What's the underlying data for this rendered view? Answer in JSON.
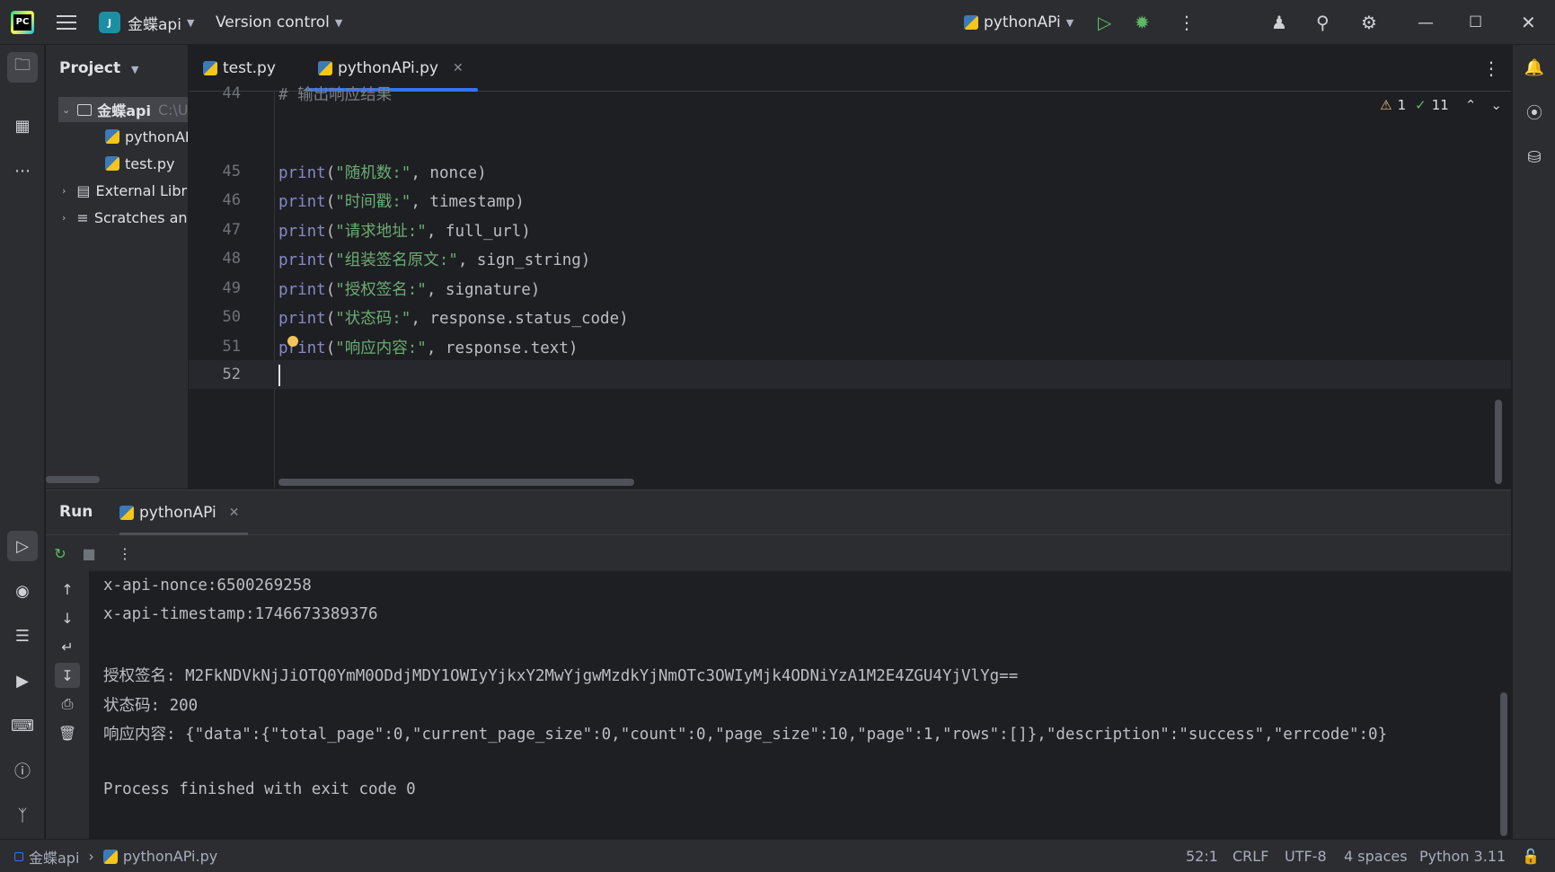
{
  "titlebar": {
    "project_badge": "J",
    "project_name": "金蝶api",
    "vcs_menu": "Version control",
    "run_config": "pythonAPi"
  },
  "project_panel": {
    "title": "Project",
    "root_label": "金蝶api",
    "root_path": "C:\\U",
    "files": [
      "pythonAPi.py",
      "test.py"
    ],
    "external_libs": "External Libraries",
    "scratches": "Scratches and Consoles"
  },
  "editor": {
    "tabs": [
      {
        "label": "test.py",
        "active": false
      },
      {
        "label": "pythonAPi.py",
        "active": true
      }
    ],
    "inspections": {
      "warnings": "1",
      "ok": "11"
    },
    "lines": [
      {
        "num": "44",
        "comment": "# 输出响应结果"
      },
      {
        "num": "45",
        "fn": "print",
        "str": "\"随机数:\"",
        "rest": ", nonce)"
      },
      {
        "num": "46",
        "fn": "print",
        "str": "\"时间戳:\"",
        "rest": ", timestamp)"
      },
      {
        "num": "47",
        "fn": "print",
        "str": "\"请求地址:\"",
        "rest": ", full_url)"
      },
      {
        "num": "48",
        "fn": "print",
        "str": "\"组装签名原文:\"",
        "rest": ", sign_string)"
      },
      {
        "num": "49",
        "fn": "print",
        "str": "\"授权签名:\"",
        "rest": ", signature)"
      },
      {
        "num": "50",
        "fn": "print",
        "str": "\"状态码:\"",
        "rest": ", response.status_code)"
      },
      {
        "num": "51",
        "fn": "print",
        "str": "\"响应内容:\"",
        "rest": ", response.text)"
      },
      {
        "num": "52",
        "fn": "",
        "str": "",
        "rest": ""
      }
    ]
  },
  "run_panel": {
    "title": "Run",
    "tab_label": "pythonAPi",
    "console": [
      "x-api-nonce:6500269258",
      "x-api-timestamp:1746673389376",
      "",
      "授权签名: M2FkNDVkNjJiOTQ0YmM0ODdjMDY1OWIyYjkxY2MwYjgwMzdkYjNmOTc3OWIyMjk4ODNiYzA1M2E4ZGU4YjVlYg==",
      "状态码: 200",
      "响应内容: {\"data\":{\"total_page\":0,\"current_page_size\":0,\"count\":0,\"page_size\":10,\"page\":1,\"rows\":[]},\"description\":\"success\",\"errcode\":0}",
      "",
      "Process finished with exit code 0"
    ]
  },
  "statusbar": {
    "project": "金蝶api",
    "file": "pythonAPi.py",
    "position": "52:1",
    "line_sep": "CRLF",
    "encoding": "UTF-8",
    "indent": "4 spaces",
    "interpreter": "Python 3.11"
  },
  "colors": {
    "accent": "#3574f0",
    "string": "#6aab73",
    "builtin": "#8888c6",
    "background": "#1e1f22",
    "panel": "#2b2d30"
  }
}
